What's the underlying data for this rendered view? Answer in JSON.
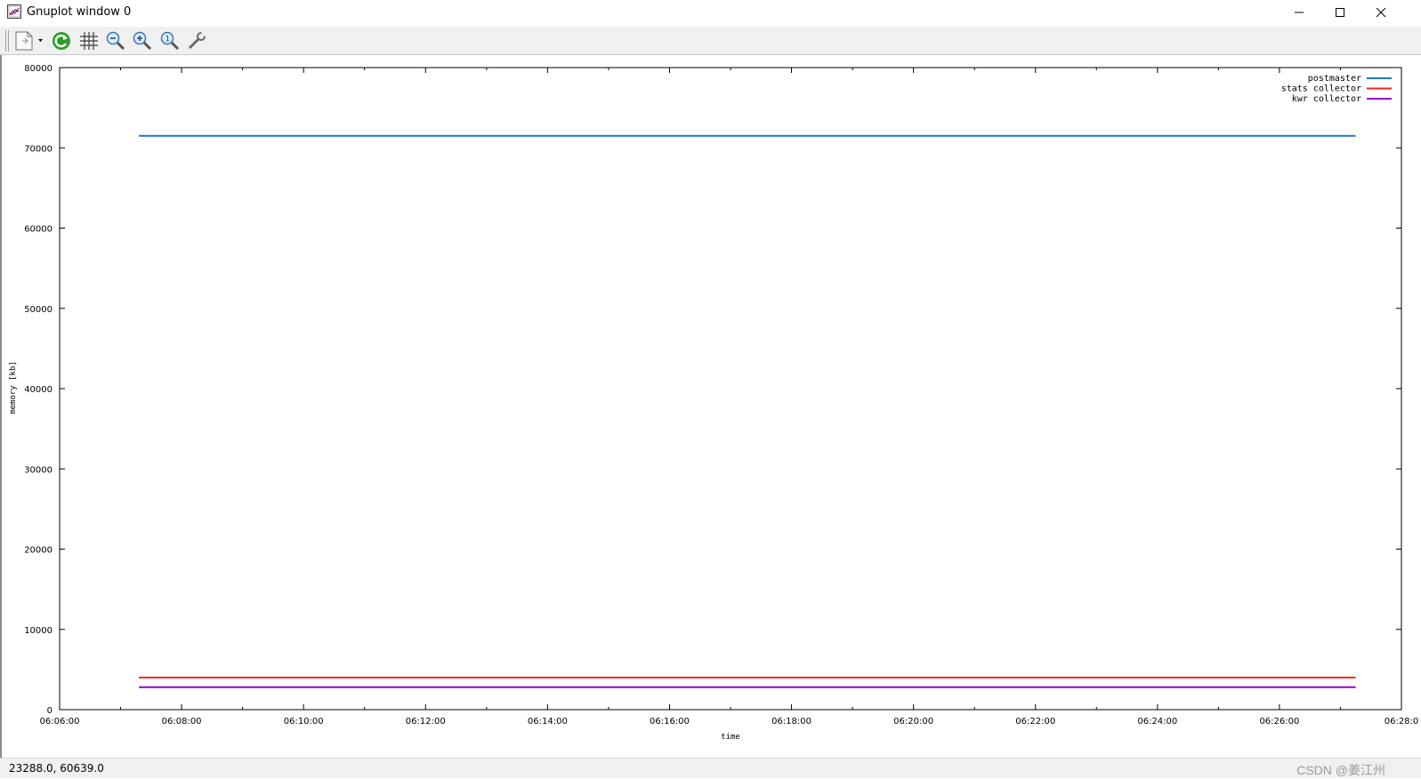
{
  "window": {
    "title": "Gnuplot window 0",
    "controls": [
      "minimize",
      "maximize",
      "close"
    ]
  },
  "toolbar": {
    "items": [
      {
        "name": "copy-print-menu-icon"
      },
      {
        "name": "replot-icon"
      },
      {
        "name": "grid-icon"
      },
      {
        "name": "zoom-out-icon"
      },
      {
        "name": "zoom-in-icon"
      },
      {
        "name": "zoom-reset-icon"
      },
      {
        "name": "options-wrench-icon"
      }
    ]
  },
  "status": {
    "coords": "23288.0,  60639.0",
    "watermark": "CSDN @姜江州"
  },
  "colors": {
    "postmaster": "#1f77c8",
    "stats_collector": "#ff2020",
    "kwr_collector": "#9400d3"
  },
  "chart_data": {
    "type": "line",
    "title": "",
    "xlabel": "time",
    "ylabel": "memory [kb]",
    "xlim": [
      "06:06:00",
      "06:28:00"
    ],
    "ylim": [
      0,
      80000
    ],
    "x_ticks": [
      "06:06:00",
      "06:08:00",
      "06:10:00",
      "06:12:00",
      "06:14:00",
      "06:16:00",
      "06:18:00",
      "06:20:00",
      "06:22:00",
      "06:24:00",
      "06:26:00",
      "06:28:0"
    ],
    "y_ticks": [
      "0",
      "10000",
      "20000",
      "30000",
      "40000",
      "50000",
      "60000",
      "70000",
      "80000"
    ],
    "legend_position": "top-right",
    "grid": false,
    "series": [
      {
        "name": "postmaster",
        "x": [
          "06:07:18",
          "06:27:15"
        ],
        "values": [
          71500,
          71500
        ]
      },
      {
        "name": "stats collector",
        "x": [
          "06:07:18",
          "06:27:15"
        ],
        "values": [
          4000,
          4000
        ]
      },
      {
        "name": "kwr collector",
        "x": [
          "06:07:18",
          "06:27:15"
        ],
        "values": [
          2800,
          2800
        ]
      }
    ]
  }
}
